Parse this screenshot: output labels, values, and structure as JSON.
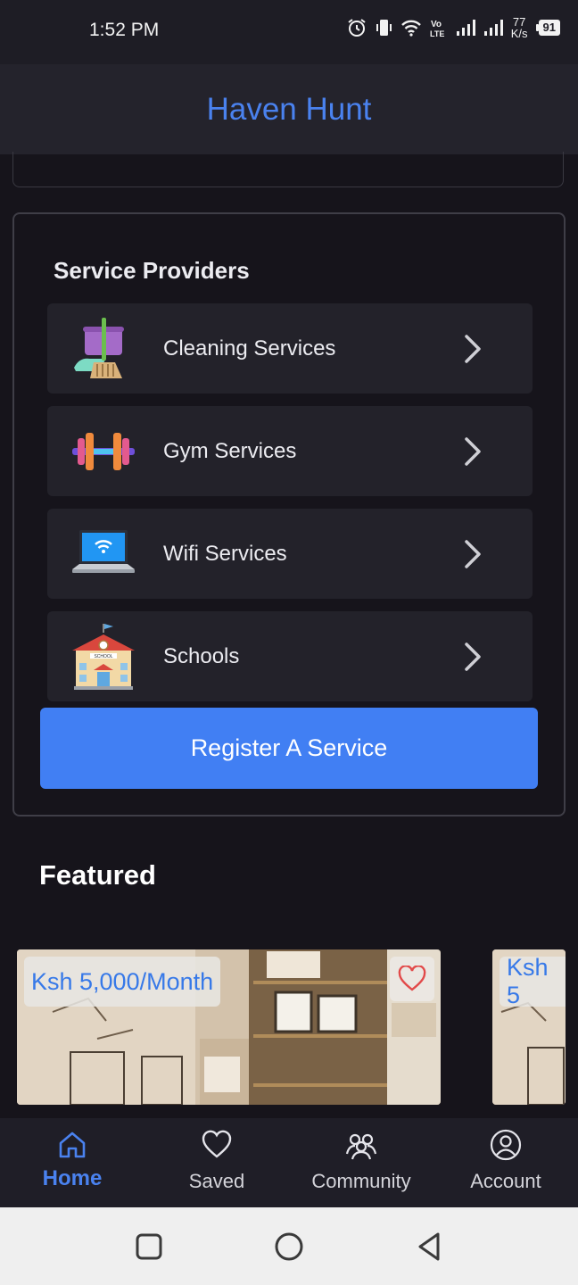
{
  "status_bar": {
    "time": "1:52 PM",
    "net_speed_value": "77",
    "net_speed_unit": "K/s",
    "battery": "91",
    "icons": [
      "alarm-icon",
      "vibrate-icon",
      "wifi-icon",
      "volte-icon",
      "signal-icon",
      "signal-icon",
      "battery-icon"
    ]
  },
  "app": {
    "title": "Haven Hunt",
    "accent_color": "#4a82ef"
  },
  "service_providers": {
    "title": "Service Providers",
    "items": [
      {
        "label": "Cleaning Services",
        "icon": "cleaning-icon"
      },
      {
        "label": "Gym Services",
        "icon": "dumbbell-icon"
      },
      {
        "label": "Wifi Services",
        "icon": "laptop-wifi-icon"
      },
      {
        "label": "Schools",
        "icon": "school-icon"
      }
    ],
    "register_label": "Register A Service",
    "button_color": "#417ff3"
  },
  "featured": {
    "title": "Featured",
    "listings": [
      {
        "price": "Ksh 5,000/Month"
      },
      {
        "price": "Ksh 5"
      }
    ]
  },
  "bottom_nav": {
    "items": [
      {
        "label": "Home",
        "icon": "home-icon",
        "active": true
      },
      {
        "label": "Saved",
        "icon": "heart-icon",
        "active": false
      },
      {
        "label": "Community",
        "icon": "community-icon",
        "active": false
      },
      {
        "label": "Account",
        "icon": "account-icon",
        "active": false
      }
    ]
  }
}
